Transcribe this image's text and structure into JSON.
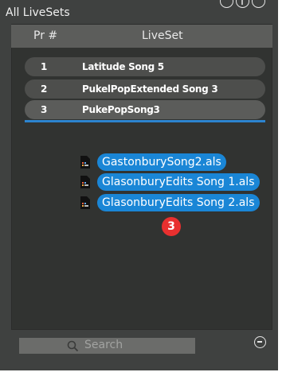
{
  "window": {
    "title": "All LiveSets"
  },
  "table": {
    "columns": [
      "Pr #",
      "LiveSet"
    ],
    "rows": [
      {
        "num": "1",
        "name": "Latitude Song 5"
      },
      {
        "num": "2",
        "name": "PukelPopExtended Song 3"
      },
      {
        "num": "3",
        "name": "PukePopSong3"
      }
    ],
    "selected_index": 2
  },
  "drag_items": [
    {
      "label": "GastonburySong2.als",
      "icon": "live-set-file-icon"
    },
    {
      "label": "GlasonburyEdits Song 1.als",
      "icon": "live-set-file-icon"
    },
    {
      "label": "GlasonburyEdits Song 2.als",
      "icon": "live-set-file-icon"
    }
  ],
  "drag_badge": "3",
  "search": {
    "placeholder": "Search",
    "icon": "search-icon"
  },
  "footer": {
    "remove_icon": "minus-circle-icon"
  },
  "colors": {
    "accent": "#1a86d6",
    "badge": "#e8302f",
    "panel": "#3f4140"
  }
}
